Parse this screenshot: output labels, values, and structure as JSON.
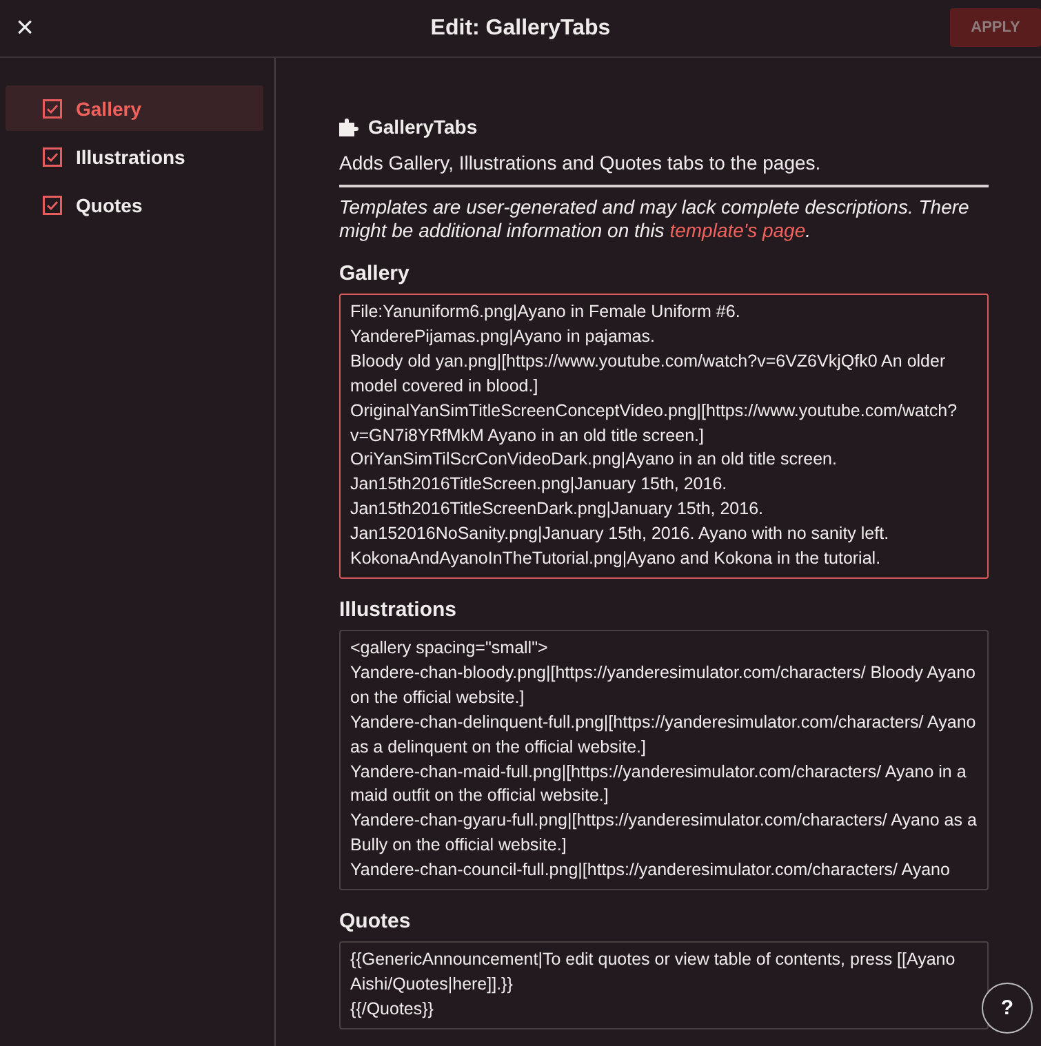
{
  "header": {
    "close_icon": "×",
    "title": "Edit: GalleryTabs",
    "apply": {
      "label": "APPLY",
      "disabled": true
    }
  },
  "sidebar": {
    "items": [
      {
        "label": "Gallery",
        "checked": true,
        "selected": true
      },
      {
        "label": "Illustrations",
        "checked": true,
        "selected": false
      },
      {
        "label": "Quotes",
        "checked": true,
        "selected": false
      }
    ]
  },
  "template": {
    "name": "GalleryTabs",
    "description": "Adds Gallery, Illustrations and Quotes tabs to the pages.",
    "notice": "Templates are user-generated and may lack complete descriptions. There might be additional information on this ",
    "notice_link": "template's page",
    "notice_end": "."
  },
  "fields": [
    {
      "label": "Gallery",
      "focused": true,
      "lines": [
        "File:Yanuniform6.png|Ayano in Female Uniform #6.",
        "YanderePijamas.png|Ayano in pajamas.",
        "Bloody old yan.png|[https://www.youtube.com/watch?v=6VZ6VkjQfk0 An older model covered in blood.]",
        "OriginalYanSimTitleScreenConceptVideo.png|[https://www.youtube.com/watch?v=GN7i8YRfMkM Ayano in an old title screen.]",
        "OriYanSimTilScrConVideoDark.png|Ayano in an old title screen.",
        "Jan15th2016TitleScreen.png|January 15th, 2016.",
        "Jan15th2016TitleScreenDark.png|January 15th, 2016.",
        "Jan152016NoSanity.png|January 15th, 2016. Ayano with no sanity left.",
        "KokonaAndAyanoInTheTutorial.png|Ayano and Kokona in the tutorial."
      ]
    },
    {
      "label": "Illustrations",
      "focused": false,
      "lines": [
        "<gallery spacing=\"small\">",
        "Yandere-chan-bloody.png|[https://yanderesimulator.com/characters/ Bloody Ayano on the official website.]",
        "Yandere-chan-delinquent-full.png|[https://yanderesimulator.com/characters/ Ayano as a delinquent on the official website.]",
        "Yandere-chan-maid-full.png|[https://yanderesimulator.com/characters/ Ayano in a maid outfit on the official website.]",
        "Yandere-chan-gyaru-full.png|[https://yanderesimulator.com/characters/ Ayano as a Bully on the official website.]",
        "Yandere-chan-council-full.png|[https://yanderesimulator.com/characters/ Ayano"
      ]
    },
    {
      "label": "Quotes",
      "focused": false,
      "lines": [
        "{{GenericAnnouncement|To edit quotes or view table of contents, press [[Ayano Aishi/Quotes|here]].}}",
        "{{/Quotes}}"
      ]
    }
  ],
  "help": {
    "icon": "?"
  }
}
